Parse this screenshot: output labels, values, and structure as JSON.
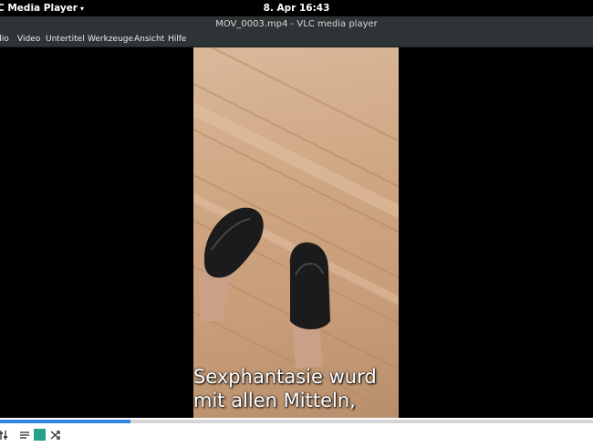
{
  "topbar": {
    "app_menu": "C Media Player",
    "app_caret": "▾",
    "clock": "8. Apr  16:43"
  },
  "window": {
    "title": "MOV_0003.mp4 - VLC media player"
  },
  "menu": {
    "items": [
      "dio",
      "Video",
      "Untertitel",
      "Werkzeuge",
      "Ansicht",
      "Hilfe"
    ]
  },
  "video": {
    "subtitle_line1": "Sexphantasie wurd",
    "subtitle_line2": "mit allen Mitteln,"
  },
  "playback": {
    "progress_fraction": 0.22
  },
  "controls": {
    "icons": [
      "equalizer-icon",
      "playlist-icon",
      "loop-icon",
      "shuffle-icon"
    ]
  },
  "colors": {
    "accent": "#3584e4",
    "loop_active": "#26a08a",
    "title_bar": "#2e3436"
  }
}
